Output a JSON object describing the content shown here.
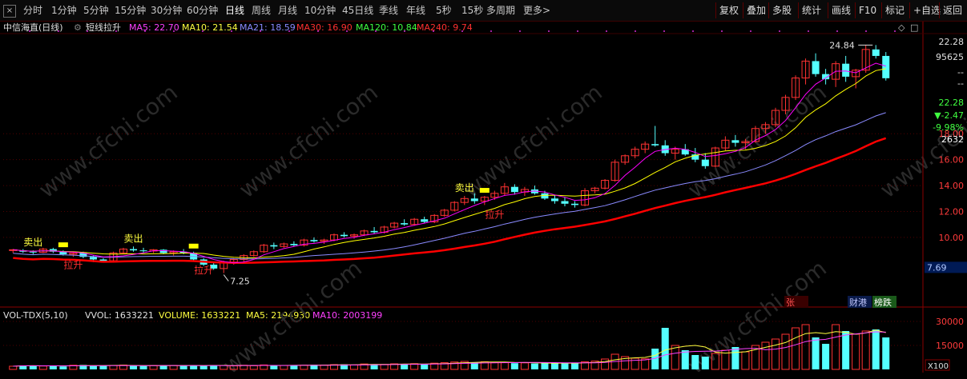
{
  "toolbar": {
    "close_label": "×",
    "periods": [
      "分时",
      "1分钟",
      "5分钟",
      "15分钟",
      "30分钟",
      "60分钟",
      "日线",
      "周线",
      "月线",
      "10分钟",
      "45日线",
      "季线",
      "年线",
      "5秒",
      "15秒",
      "多周期",
      "更多>"
    ],
    "active_period": "日线",
    "right_buttons": [
      "复权",
      "叠加",
      "多股",
      "统计",
      "画线",
      "F10",
      "标记",
      "+自选",
      "返回"
    ]
  },
  "chart_header": {
    "stock_name": "中信海直(日线)",
    "indicator": "短线拉升",
    "ma5": "MA5: 22.70",
    "ma10": "MA10: 21.54",
    "ma21": "MA21: 18.59",
    "ma30": "MA30: 16.90",
    "ma120": "MA120: 10.84",
    "ma240": "MA240: 9.74"
  },
  "volume_header": {
    "name": "VOL-TDX(5,10)",
    "vvol": "VVOL: 1633221",
    "volume": "VOLUME: 1633221",
    "ma5": "MA5: 2194930",
    "ma10": "MA10: 2003199"
  },
  "right_panel": {
    "price_top": "22.28",
    "vol_top": "95625",
    "dash1": "--",
    "dash2": "--",
    "price": "22.28",
    "change": "▼-2.47",
    "change_pct": "-9.98%",
    "vol": "2632"
  },
  "watermark": "www.cfchi.com",
  "annotations": {
    "sell_label": "卖出",
    "rise_label": "拉升",
    "high_label": "24.84",
    "low_label": "7.25",
    "tag_zhang": "张",
    "tag_caigang": "财港",
    "tag_bangdie": "榜跌"
  },
  "colors": {
    "up": "#ff3232",
    "down": "#54ffff",
    "ma5": "#ff00ff",
    "ma10": "#ffff00",
    "ma21": "#8a8aff",
    "ma30": "#ff0000",
    "vol_up": "#ff3232",
    "vol_down": "#54ffff"
  },
  "chart_data": {
    "type": "candlestick",
    "y_axis_ticks": [
      18.0,
      16.0,
      14.0,
      12.0,
      10.0
    ],
    "last_price": 7.69,
    "volume_axis_ticks": [
      30000,
      15000
    ],
    "volume_unit": "X100",
    "ohlc": [
      [
        9.0,
        9.1,
        8.8,
        9.05
      ],
      [
        9.0,
        9.1,
        8.8,
        8.9
      ],
      [
        8.9,
        9.0,
        8.7,
        8.85
      ],
      [
        8.85,
        9.2,
        8.8,
        9.1
      ],
      [
        9.1,
        9.2,
        8.8,
        8.9
      ],
      [
        8.9,
        9.0,
        8.6,
        8.7
      ],
      [
        8.7,
        8.9,
        8.5,
        8.8
      ],
      [
        8.8,
        8.9,
        8.4,
        8.5
      ],
      [
        8.5,
        8.6,
        8.1,
        8.3
      ],
      [
        8.3,
        8.4,
        8.1,
        8.2
      ],
      [
        8.2,
        8.9,
        8.1,
        8.8
      ],
      [
        8.8,
        9.2,
        8.7,
        9.1
      ],
      [
        9.1,
        9.3,
        8.9,
        9.0
      ],
      [
        9.0,
        9.2,
        8.8,
        8.95
      ],
      [
        8.95,
        9.1,
        8.8,
        9.05
      ],
      [
        9.05,
        9.1,
        8.7,
        8.8
      ],
      [
        8.8,
        9.0,
        8.6,
        8.9
      ],
      [
        8.9,
        9.1,
        8.7,
        8.8
      ],
      [
        8.8,
        8.9,
        8.2,
        8.3
      ],
      [
        8.3,
        8.4,
        7.8,
        7.9
      ],
      [
        7.9,
        8.1,
        7.5,
        7.6
      ],
      [
        7.6,
        8.2,
        7.25,
        8.1
      ],
      [
        8.1,
        8.4,
        7.9,
        8.3
      ],
      [
        8.3,
        8.7,
        8.1,
        8.6
      ],
      [
        8.6,
        9.0,
        8.5,
        8.9
      ],
      [
        8.9,
        9.5,
        8.8,
        9.4
      ],
      [
        9.4,
        9.6,
        9.1,
        9.3
      ],
      [
        9.3,
        9.6,
        9.2,
        9.5
      ],
      [
        9.5,
        9.7,
        9.3,
        9.4
      ],
      [
        9.4,
        9.9,
        9.3,
        9.8
      ],
      [
        9.8,
        10.0,
        9.6,
        9.7
      ],
      [
        9.7,
        9.9,
        9.5,
        9.8
      ],
      [
        9.8,
        10.3,
        9.7,
        10.2
      ],
      [
        10.2,
        10.4,
        10.0,
        10.1
      ],
      [
        10.1,
        10.3,
        9.9,
        10.2
      ],
      [
        10.2,
        10.6,
        10.1,
        10.5
      ],
      [
        10.5,
        10.8,
        10.3,
        10.4
      ],
      [
        10.4,
        10.9,
        10.3,
        10.8
      ],
      [
        10.8,
        11.2,
        10.7,
        11.1
      ],
      [
        11.1,
        11.4,
        10.9,
        11.0
      ],
      [
        11.0,
        11.5,
        10.9,
        11.4
      ],
      [
        11.4,
        11.6,
        11.1,
        11.2
      ],
      [
        11.2,
        11.8,
        11.1,
        11.7
      ],
      [
        11.7,
        12.2,
        11.6,
        12.1
      ],
      [
        12.1,
        12.8,
        12.0,
        12.7
      ],
      [
        12.7,
        13.2,
        12.5,
        13.0
      ],
      [
        13.0,
        13.4,
        12.6,
        12.8
      ],
      [
        12.8,
        13.2,
        12.5,
        13.1
      ],
      [
        13.1,
        13.6,
        12.9,
        13.4
      ],
      [
        13.4,
        14.2,
        13.2,
        13.9
      ],
      [
        13.9,
        14.1,
        13.3,
        13.5
      ],
      [
        13.5,
        13.9,
        13.2,
        13.7
      ],
      [
        13.7,
        14.0,
        13.3,
        13.4
      ],
      [
        13.4,
        13.6,
        12.9,
        13.0
      ],
      [
        13.0,
        13.3,
        12.6,
        12.8
      ],
      [
        12.8,
        13.1,
        12.4,
        12.6
      ],
      [
        12.6,
        12.8,
        12.3,
        12.5
      ],
      [
        12.5,
        13.8,
        12.4,
        13.6
      ],
      [
        13.6,
        13.9,
        13.4,
        13.8
      ],
      [
        13.8,
        14.5,
        13.7,
        14.4
      ],
      [
        14.4,
        16.0,
        14.3,
        15.8
      ],
      [
        15.8,
        16.4,
        15.6,
        16.3
      ],
      [
        16.3,
        17.0,
        16.1,
        16.8
      ],
      [
        16.8,
        17.4,
        16.5,
        17.2
      ],
      [
        17.2,
        18.6,
        17.0,
        17.1
      ],
      [
        17.1,
        17.5,
        16.3,
        16.5
      ],
      [
        16.5,
        17.0,
        16.0,
        16.8
      ],
      [
        16.8,
        17.2,
        16.3,
        16.4
      ],
      [
        16.4,
        16.9,
        15.8,
        16.0
      ],
      [
        16.0,
        16.5,
        15.3,
        15.5
      ],
      [
        15.5,
        17.0,
        15.4,
        16.9
      ],
      [
        16.9,
        17.8,
        16.7,
        17.5
      ],
      [
        17.5,
        17.9,
        17.0,
        17.3
      ],
      [
        17.3,
        17.6,
        16.8,
        17.4
      ],
      [
        17.4,
        18.6,
        17.3,
        18.4
      ],
      [
        18.4,
        18.9,
        18.0,
        18.7
      ],
      [
        18.7,
        20.0,
        18.5,
        19.8
      ],
      [
        19.8,
        21.0,
        19.5,
        20.8
      ],
      [
        20.8,
        22.5,
        20.6,
        22.3
      ],
      [
        22.3,
        23.8,
        21.8,
        23.6
      ],
      [
        23.6,
        24.2,
        22.4,
        22.6
      ],
      [
        22.6,
        23.0,
        21.8,
        22.2
      ],
      [
        22.2,
        23.6,
        21.6,
        23.4
      ],
      [
        23.4,
        24.0,
        22.0,
        22.4
      ],
      [
        22.4,
        23.0,
        21.5,
        22.9
      ],
      [
        22.9,
        24.84,
        22.7,
        24.5
      ],
      [
        24.5,
        24.84,
        23.8,
        24.0
      ],
      [
        24.0,
        24.3,
        22.1,
        22.28
      ]
    ],
    "volume": [
      2000,
      2500,
      2400,
      2100,
      2300,
      1900,
      2600,
      2800,
      2300,
      2400,
      2500,
      2700,
      2300,
      2200,
      2400,
      2300,
      2500,
      2600,
      2400,
      2300,
      2700,
      2500,
      2200,
      2600,
      2300,
      2800,
      2400,
      2500,
      2700,
      2600,
      2900,
      2700,
      3000,
      3200,
      2800,
      3400,
      3300,
      3100,
      3500,
      3400,
      3600,
      3200,
      3900,
      4200,
      4600,
      5000,
      4400,
      4800,
      4500,
      4200,
      3900,
      4100,
      3700,
      4000,
      3800,
      4100,
      3900,
      4800,
      5200,
      6500,
      9500,
      8000,
      7000,
      6600,
      13000,
      26000,
      15000,
      12000,
      9000,
      8000,
      10000,
      12000,
      14000,
      11000,
      15000,
      17000,
      19000,
      22000,
      26000,
      28000,
      20000,
      16000,
      28000,
      24000,
      22000,
      24000,
      25000,
      20000
    ],
    "series": [
      {
        "name": "MA5",
        "values": []
      },
      {
        "name": "MA10",
        "values": []
      },
      {
        "name": "MA21",
        "values": []
      },
      {
        "name": "MA30",
        "values": []
      }
    ]
  }
}
